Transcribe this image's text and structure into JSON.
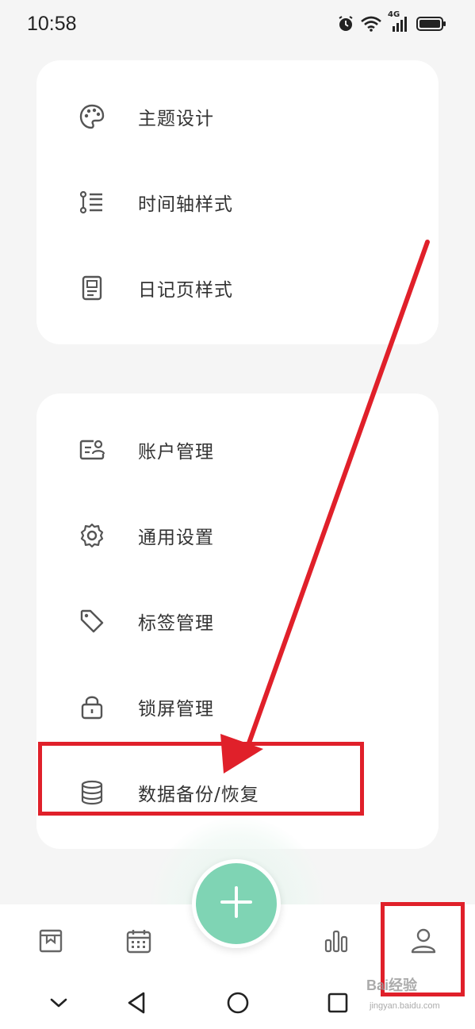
{
  "status_bar": {
    "time": "10:58",
    "network_label": "4G",
    "icons": [
      "alarm-icon",
      "wifi-icon",
      "signal-icon",
      "battery-icon"
    ]
  },
  "group_display": {
    "items": [
      {
        "label": "主题设计",
        "icon": "palette-icon"
      },
      {
        "label": "时间轴样式",
        "icon": "timeline-icon"
      },
      {
        "label": "日记页样式",
        "icon": "page-icon"
      }
    ]
  },
  "group_settings": {
    "items": [
      {
        "label": "账户管理",
        "icon": "account-card-icon"
      },
      {
        "label": "通用设置",
        "icon": "gear-icon"
      },
      {
        "label": "标签管理",
        "icon": "tag-icon"
      },
      {
        "label": "锁屏管理",
        "icon": "lock-icon"
      },
      {
        "label": "数据备份/恢复",
        "icon": "database-icon"
      }
    ]
  },
  "bottom_tabs": {
    "items": [
      "diary-book-icon",
      "calendar-icon",
      "add-icon",
      "stats-icon",
      "profile-icon"
    ],
    "fab_color": "#7fd4b4",
    "active": "profile-icon"
  },
  "nav_bar": {
    "buttons": [
      "chevron-down-icon",
      "back-icon",
      "home-icon",
      "recents-icon"
    ]
  },
  "annotation": {
    "color": "#e0202a"
  },
  "watermark": {
    "text": "Bai经验",
    "sub": "jingyan.baidu.com"
  }
}
